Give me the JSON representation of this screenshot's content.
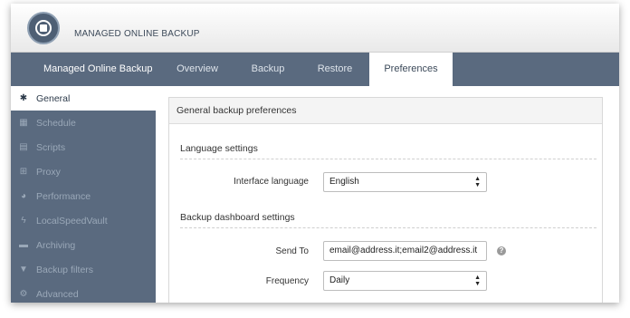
{
  "header": {
    "app_title": "MANAGED ONLINE BACKUP"
  },
  "nav": {
    "brand": "Managed Online Backup",
    "tabs": [
      {
        "label": "Overview"
      },
      {
        "label": "Backup"
      },
      {
        "label": "Restore"
      },
      {
        "label": "Preferences"
      }
    ]
  },
  "sidebar": {
    "items": [
      {
        "label": "General",
        "icon": "gear-icon"
      },
      {
        "label": "Schedule",
        "icon": "calendar-icon"
      },
      {
        "label": "Scripts",
        "icon": "document-icon"
      },
      {
        "label": "Proxy",
        "icon": "network-icon"
      },
      {
        "label": "Performance",
        "icon": "dashboard-icon"
      },
      {
        "label": "LocalSpeedVault",
        "icon": "bolt-icon"
      },
      {
        "label": "Archiving",
        "icon": "folder-icon"
      },
      {
        "label": "Backup filters",
        "icon": "filter-icon"
      },
      {
        "label": "Advanced",
        "icon": "cogs-icon"
      }
    ]
  },
  "main": {
    "panel_title": "General backup preferences",
    "language_section": {
      "title": "Language settings",
      "interface_language_label": "Interface language",
      "interface_language_value": "English"
    },
    "dashboard_section": {
      "title": "Backup dashboard settings",
      "send_to_label": "Send To",
      "send_to_value": "email@address.it;email2@address.it",
      "frequency_label": "Frequency",
      "frequency_value": "Daily"
    }
  },
  "colors": {
    "nav_bg": "#5a6a7f",
    "sidebar_text": "#9aa8b8",
    "active_bg": "#ffffff"
  }
}
